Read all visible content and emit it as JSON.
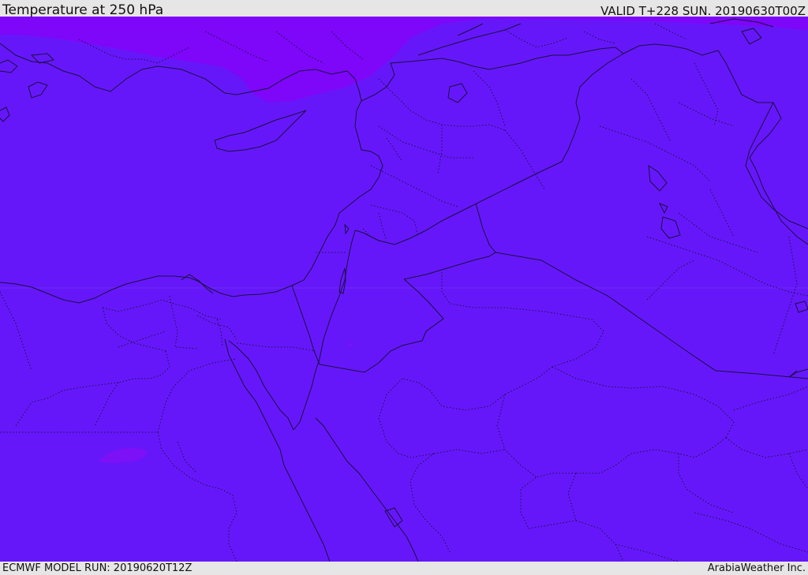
{
  "header": {
    "title": "Temperature at 250 hPa",
    "valid": "VALID T+228 SUN. 20190630T00Z"
  },
  "footer": {
    "model_run": "ECMWF MODEL RUN: 20190620T12Z",
    "brand": "ArabiaWeather Inc."
  },
  "map": {
    "region": "Eastern Mediterranean / Middle East",
    "fill_colors": {
      "main": "#6617fa",
      "cold": "#7e06f9",
      "small_cold": "#7c10f7"
    }
  }
}
